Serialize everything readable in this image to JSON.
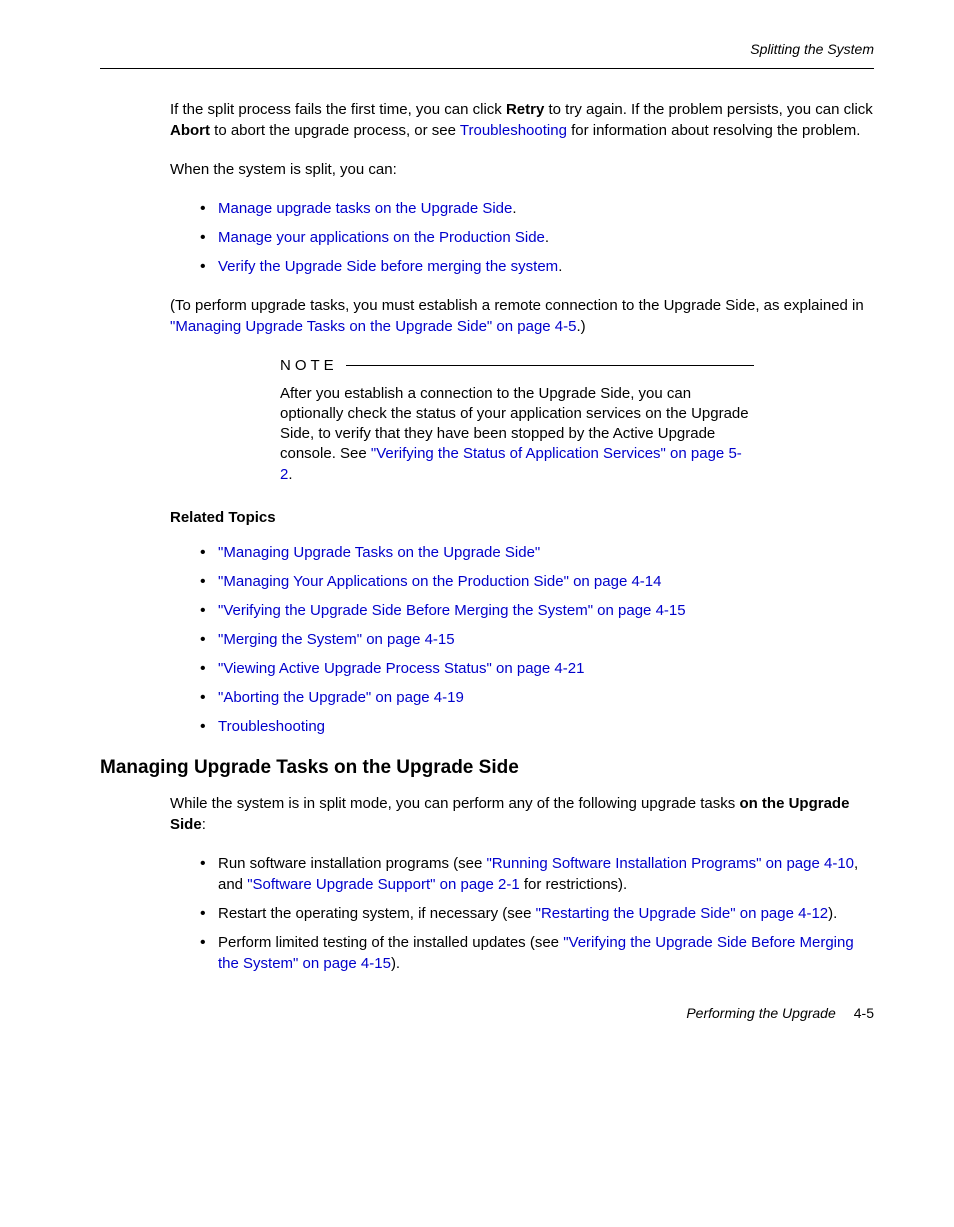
{
  "header": {
    "section_title": "Splitting the System"
  },
  "para1": {
    "part1": "If the split process fails the first time, you can click ",
    "bold1": "Retry",
    "part2": " to try again. If the problem persists, you can click ",
    "bold2": "Abort",
    "part3": " to abort the upgrade process, or see ",
    "link1": "Troubleshooting",
    "part4": " for information about resolving the problem."
  },
  "para2": "When the system is split, you can:",
  "list1": [
    {
      "link": "Manage upgrade tasks on the Upgrade Side",
      "after": "."
    },
    {
      "link": "Manage your applications on the Production Side",
      "after": "."
    },
    {
      "link": "Verify the Upgrade Side before merging the system",
      "after": "."
    }
  ],
  "para3": {
    "part1": "(To perform upgrade tasks, you must establish a remote connection to the Upgrade Side, as explained in ",
    "link1": "\"Managing Upgrade Tasks on the Upgrade Side\" on page 4-5",
    "part2": ".)"
  },
  "note": {
    "label": "NOTE",
    "text_part1": "After you establish a connection to the Upgrade Side, you can optionally check the status of your application services on the Upgrade Side, to verify that they have been stopped by the Active Upgrade console. See ",
    "link1": "\"Verifying the Status of Application Services\" on page 5-2",
    "text_part2": "."
  },
  "related": {
    "heading": "Related Topics",
    "items": [
      "\"Managing Upgrade Tasks on the Upgrade Side\"",
      "\"Managing Your Applications on the Production Side\" on page 4-14",
      "\"Verifying the Upgrade Side Before Merging the System\" on page 4-15",
      "\"Merging the System\" on page 4-15",
      "\"Viewing Active Upgrade Process Status\" on page 4-21",
      "\"Aborting the Upgrade\" on page 4-19",
      "Troubleshooting"
    ]
  },
  "section2": {
    "heading": "Managing Upgrade Tasks on the Upgrade Side",
    "para1_part1": "While the system is in split mode, you can perform any of the following upgrade tasks ",
    "para1_bold": "on the Upgrade Side",
    "para1_part2": ":",
    "items": [
      {
        "text1": "Run software installation programs (see ",
        "link1": "\"Running Software Installation Programs\" on page 4-10",
        "text2": ", and ",
        "link2": "\"Software Upgrade Support\" on page 2-1",
        "text3": " for restrictions)."
      },
      {
        "text1": "Restart the operating system, if necessary (see ",
        "link1": "\"Restarting the Upgrade Side\" on page 4-12",
        "text2": ").",
        "link2": "",
        "text3": ""
      },
      {
        "text1": "Perform limited testing of the installed updates (see ",
        "link1": "\"Verifying the Upgrade Side Before Merging the System\" on page 4-15",
        "text2": ").",
        "link2": "",
        "text3": ""
      }
    ]
  },
  "footer": {
    "label": "Performing the Upgrade",
    "page": "4-5"
  }
}
